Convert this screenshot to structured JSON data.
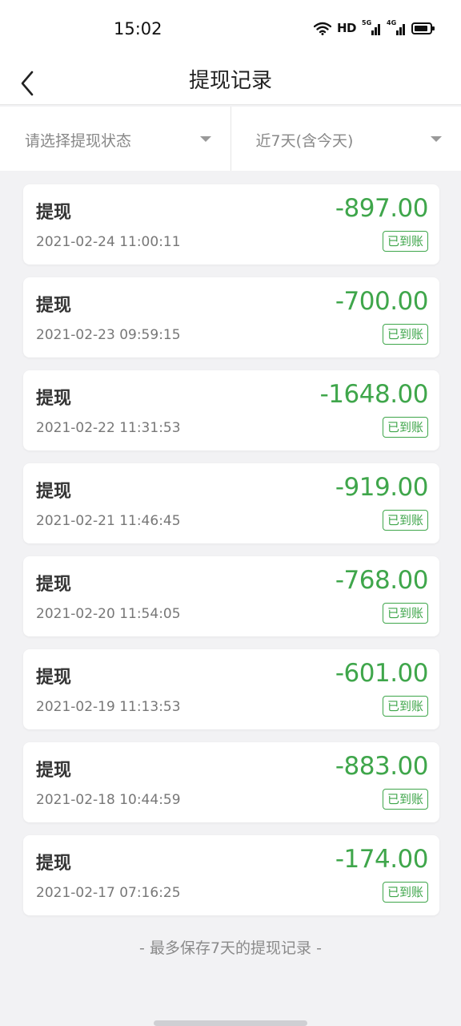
{
  "status_bar": {
    "time": "15:02",
    "hd_label": "HD",
    "sim1_network": "5G",
    "sim2_network": "4G",
    "icons": [
      "wifi-icon",
      "signal-icon",
      "signal-icon",
      "battery-icon"
    ]
  },
  "header": {
    "title": "提现记录",
    "back_icon": "chevron-left-icon"
  },
  "filters": {
    "status_placeholder": "请选择提现状态",
    "date_range": "近7天(含今天)",
    "caret_icon": "caret-down-icon"
  },
  "records": [
    {
      "type": "提现",
      "time": "2021-02-24 11:00:11",
      "amount": "-897.00",
      "status": "已到账"
    },
    {
      "type": "提现",
      "time": "2021-02-23 09:59:15",
      "amount": "-700.00",
      "status": "已到账"
    },
    {
      "type": "提现",
      "time": "2021-02-22 11:31:53",
      "amount": "-1648.00",
      "status": "已到账"
    },
    {
      "type": "提现",
      "time": "2021-02-21 11:46:45",
      "amount": "-919.00",
      "status": "已到账"
    },
    {
      "type": "提现",
      "time": "2021-02-20 11:54:05",
      "amount": "-768.00",
      "status": "已到账"
    },
    {
      "type": "提现",
      "time": "2021-02-19 11:13:53",
      "amount": "-601.00",
      "status": "已到账"
    },
    {
      "type": "提现",
      "time": "2021-02-18 10:44:59",
      "amount": "-883.00",
      "status": "已到账"
    },
    {
      "type": "提现",
      "time": "2021-02-17 07:16:25",
      "amount": "-174.00",
      "status": "已到账"
    }
  ],
  "footer": {
    "note": "- 最多保存7天的提现记录 -"
  },
  "colors": {
    "accent_green": "#3fa64b",
    "background": "#f2f2f4",
    "card": "#ffffff"
  }
}
